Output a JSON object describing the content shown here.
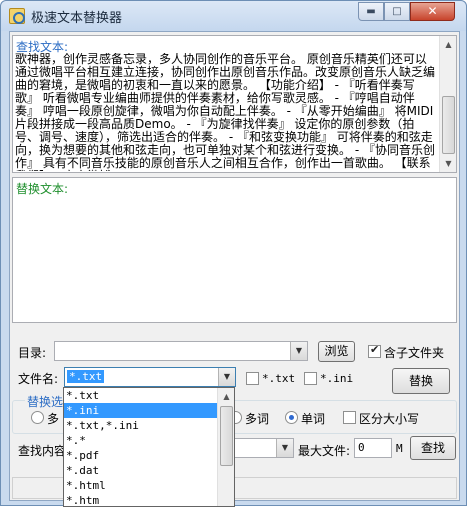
{
  "window": {
    "title": "极速文本替换器",
    "minimize": "▬",
    "maximize": "□",
    "close": "✕"
  },
  "find": {
    "label": "查找文本:",
    "text": "歌神器，创作灵感备忘录，多人协同创作的音乐平台。 原创音乐精英们还可以通过微唱平台相互建立连接，协同创作出原创音乐作品。改变原创音乐人缺乏编曲的窘境，是微唱的初衷和一直以来的愿景。 【功能介绍】 - 『听看伴奏写歌』 听看微唱专业编曲师提供的伴奏素材，给你写歌灵感。 - 『哼唱自动伴奏』 哼唱一段原创旋律，微唱为你自动配上伴奏。 - 『从零开始编曲』 将MIDI 片段拼接成一段高品质Demo。 - 『为旋律找伴奏』 设定你的原创参数（拍号、调号、速度），筛选出适合的伴奏。 - 『和弦变换功能』 可将伴奏的和弦走向，换为想要的其他和弦走向，也可单独对某个和弦进行变换。 - 『协同音乐创作』 具有不同音乐技能的原创音乐人之间相互合作，创作出一首歌曲。 【联系我们】 - 官方微博："
  },
  "replace": {
    "label": "替换文本:",
    "text": ""
  },
  "directory": {
    "label": "目录:",
    "value": "",
    "browse_label": "浏览",
    "include_subfolders_label": "含子文件夹",
    "include_subfolders_checked": true
  },
  "filename": {
    "label": "文件名:",
    "value": "*.txt",
    "quick_txt_label": "*.txt",
    "quick_ini_label": "*.ini",
    "replace_button": "替换",
    "options": [
      "*.txt",
      "*.ini",
      "*.txt,*.ini",
      "*.*",
      "*.pdf",
      "*.dat",
      "*.html",
      "*.htm"
    ],
    "selected_option": "*.ini"
  },
  "replace_options": {
    "group_label": "替换选",
    "radio_left_label": "多",
    "multi_word_label": "多词",
    "single_word_label": "单词",
    "single_word_selected": true,
    "case_sensitive_label": "区分大小写",
    "case_sensitive_checked": false
  },
  "search": {
    "content_label": "查找内容",
    "max_file_label": "最大文件:",
    "max_file_value": "0",
    "max_file_unit": "M",
    "search_button": "查找"
  }
}
